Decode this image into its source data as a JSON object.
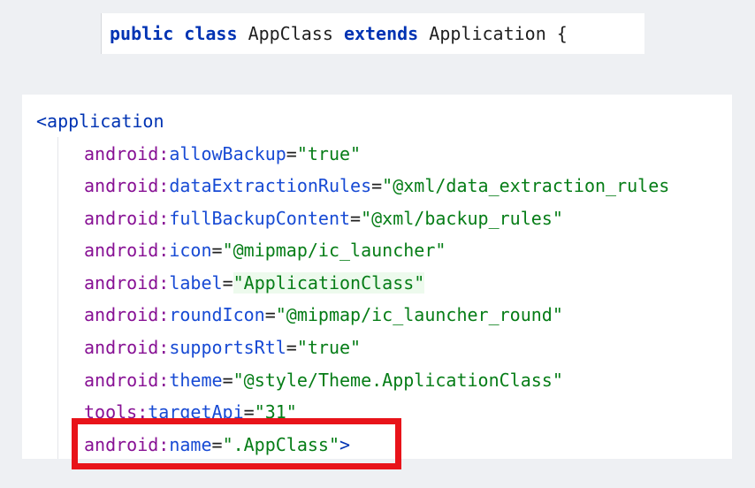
{
  "java_line": {
    "kw_public": "public",
    "kw_class": "class",
    "class_name": "AppClass",
    "kw_extends": "extends",
    "parent_class": "Application",
    "brace": "{"
  },
  "xml": {
    "open_tag": "<application",
    "attributes": [
      {
        "ns": "android",
        "name": "allowBackup",
        "value": "\"true\""
      },
      {
        "ns": "android",
        "name": "dataExtractionRules",
        "value": "\"@xml/data_extraction_rules"
      },
      {
        "ns": "android",
        "name": "fullBackupContent",
        "value": "\"@xml/backup_rules\""
      },
      {
        "ns": "android",
        "name": "icon",
        "value": "\"@mipmap/ic_launcher\""
      },
      {
        "ns": "android",
        "name": "label",
        "value": "\"ApplicationClass\""
      },
      {
        "ns": "android",
        "name": "roundIcon",
        "value": "\"@mipmap/ic_launcher_round\""
      },
      {
        "ns": "android",
        "name": "supportsRtl",
        "value": "\"true\""
      },
      {
        "ns": "android",
        "name": "theme",
        "value": "\"@style/Theme.ApplicationClass\""
      },
      {
        "ns": "tools",
        "name": "targetApi",
        "value": "\"31\""
      },
      {
        "ns": "android",
        "name": "name",
        "value": "\".AppClass\"",
        "suffix": ">"
      }
    ],
    "separator": ":",
    "equals": "="
  },
  "colors": {
    "keyword": "#0033b3",
    "namespace": "#871094",
    "attribute": "#174ad4",
    "string": "#067d17",
    "annotation_box": "#e8131a"
  }
}
